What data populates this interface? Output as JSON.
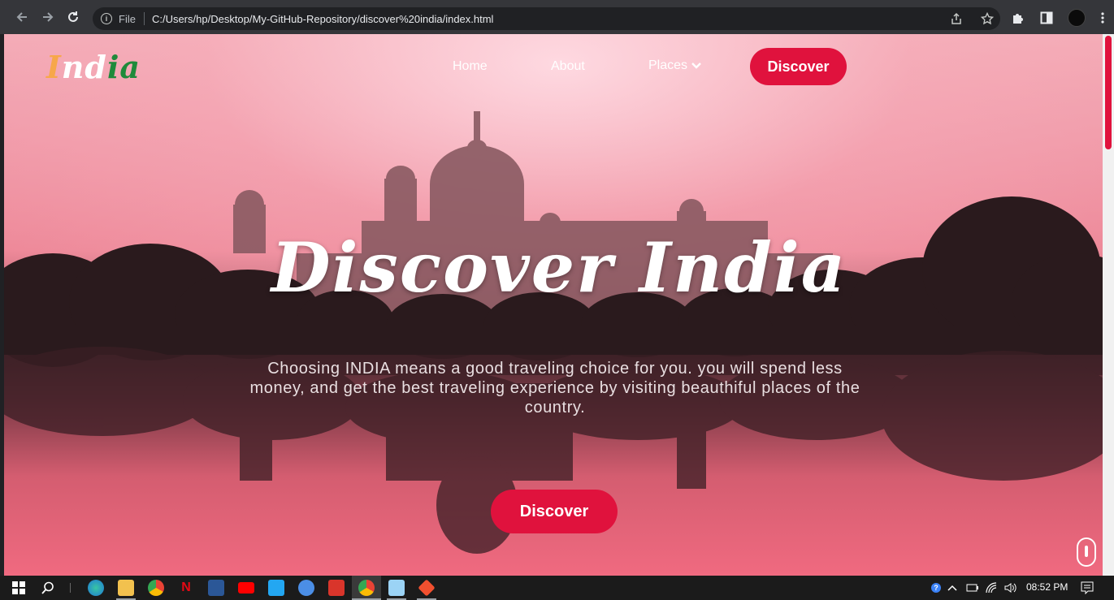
{
  "browser": {
    "file_label": "File",
    "url": "C:/Users/hp/Desktop/My-GitHub-Repository/discover%20india/index.html"
  },
  "site": {
    "brand": {
      "letters": [
        "I",
        "nd",
        "ia"
      ]
    },
    "nav": {
      "home": "Home",
      "about": "About",
      "places": "Places",
      "discover": "Discover"
    },
    "hero": {
      "title": "Discover India",
      "text": "Choosing INDIA means a good traveling choice for you. you will spend less money, and get the best traveling experience by visiting beauthiful places of the country.",
      "button": "Discover"
    },
    "colors": {
      "accent": "#e0123d",
      "saffron": "#f7a74a",
      "green": "#1f8a3b"
    }
  },
  "taskbar": {
    "time": "08:52 PM",
    "apps": [
      "edge-icon",
      "file-explorer-icon",
      "chrome-icon",
      "netflix-icon",
      "calculator-icon",
      "youtube-icon",
      "vscode-icon",
      "app-icon",
      "pdf-icon",
      "chrome-icon",
      "notepad-icon",
      "git-icon"
    ]
  }
}
